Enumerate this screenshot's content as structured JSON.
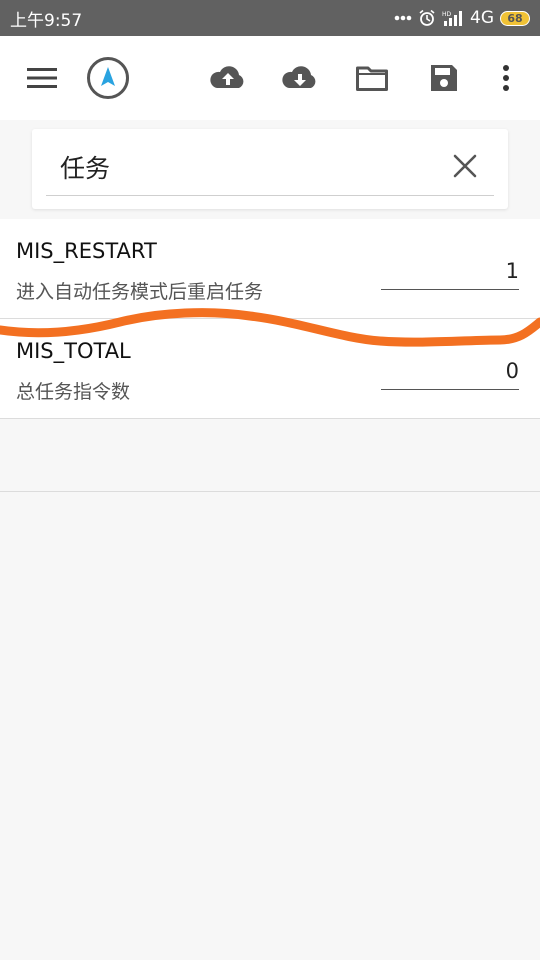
{
  "status_bar": {
    "time": "上午9:57",
    "network": "4G",
    "battery": "68",
    "icons": [
      "more-dots-icon",
      "alarm-icon",
      "hd-signal-icon",
      "battery-icon"
    ]
  },
  "toolbar": {
    "icons": [
      "menu-icon",
      "compass-icon",
      "upload-cloud-icon",
      "download-cloud-icon",
      "folder-icon",
      "save-icon",
      "more-vert-icon"
    ],
    "accent": "#29a3e0"
  },
  "search": {
    "value": "任务"
  },
  "params": [
    {
      "name": "MIS_RESTART",
      "description": "进入自动任务模式后重启任务",
      "value": "1"
    },
    {
      "name": "MIS_TOTAL",
      "description": "总任务指令数",
      "value": "0"
    }
  ],
  "annotation": {
    "color": "#f37021"
  }
}
